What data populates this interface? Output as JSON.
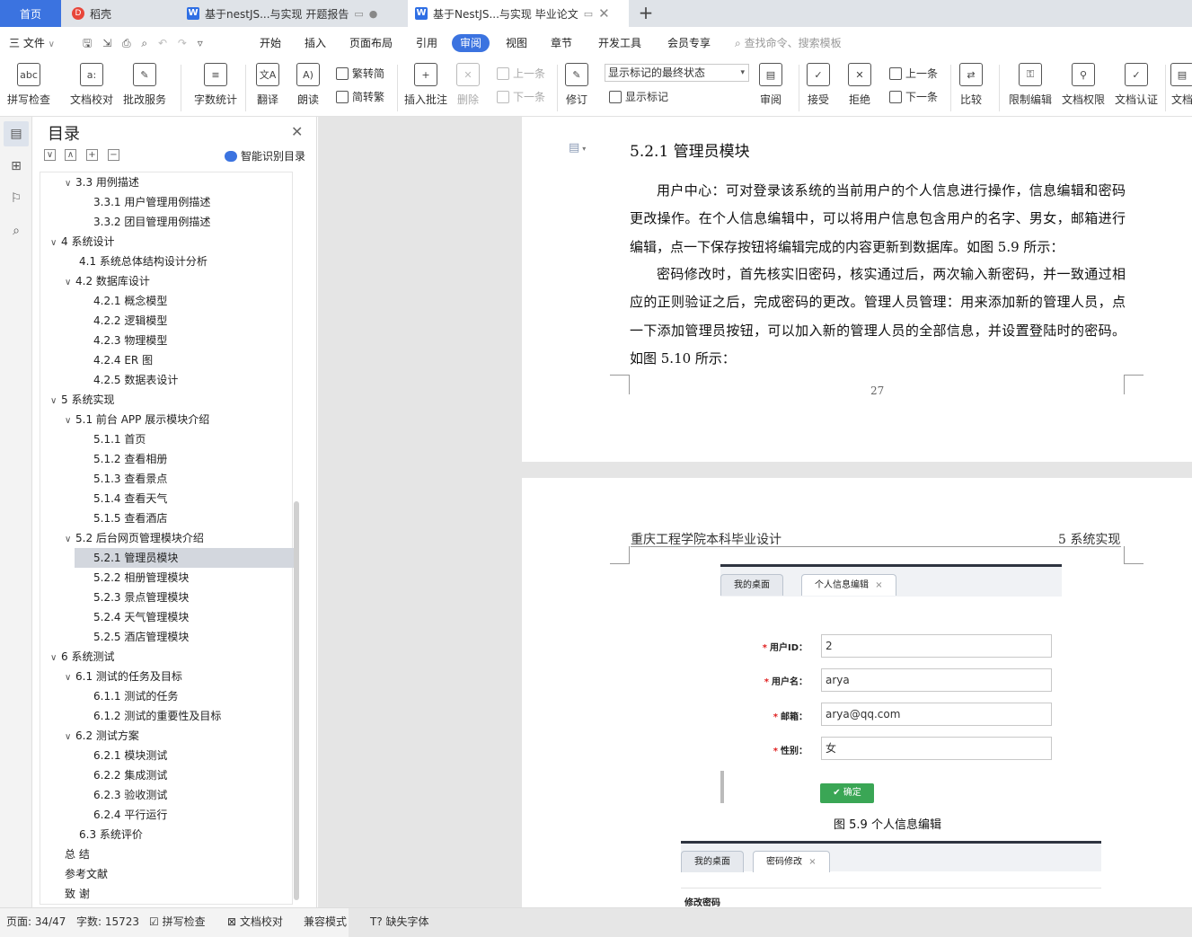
{
  "tabs": {
    "home": "首页",
    "daoke": "稻壳",
    "kaiti": "基于nestJS...与实现 开题报告",
    "lunwen": "基于NestJS...与实现 毕业论文"
  },
  "menu": {
    "file": "三 文件",
    "items": [
      "开始",
      "插入",
      "页面布局",
      "引用",
      "审阅",
      "视图",
      "章节",
      "开发工具",
      "会员专享"
    ],
    "search": "查找命令、搜索模板"
  },
  "ribbon": {
    "spell": "拼写检查",
    "proof": "文档校对",
    "review_service": "批改服务",
    "word_count": "字数统计",
    "translate": "翻译",
    "read_aloud": "朗读",
    "to_trad": "繁转简",
    "to_simp": "简转繁",
    "insert_comment": "插入批注",
    "delete": "删除",
    "prev": "上一条",
    "next": "下一条",
    "track": "修订",
    "markup_state": "显示标记的最终状态",
    "show_markup": "显示标记",
    "review_pane": "审阅",
    "accept": "接受",
    "reject": "拒绝",
    "prev2": "上一条",
    "next2": "下一条",
    "compare": "比较",
    "restrict": "限制编辑",
    "permission": "文档权限",
    "certify": "文档认证",
    "more": "文档"
  },
  "toc": {
    "title": "目录",
    "smart": "智能识别目录",
    "items": [
      {
        "level": 2,
        "text": "3.3 用例描述",
        "arrow": "∨"
      },
      {
        "level": 3,
        "text": "3.3.1 用户管理用例描述"
      },
      {
        "level": 3,
        "text": "3.3.2 团目管理用例描述"
      },
      {
        "level": 1,
        "text": "4 系统设计",
        "arrow": "∨"
      },
      {
        "level": 2,
        "text": "4.1 系统总体结构设计分析"
      },
      {
        "level": 2,
        "text": "4.2 数据库设计",
        "arrow": "∨"
      },
      {
        "level": 3,
        "text": "4.2.1  概念模型"
      },
      {
        "level": 3,
        "text": "4.2.2  逻辑模型"
      },
      {
        "level": 3,
        "text": "4.2.3  物理模型"
      },
      {
        "level": 3,
        "text": "4.2.4 ER 图"
      },
      {
        "level": 3,
        "text": "4.2.5  数据表设计"
      },
      {
        "level": 1,
        "text": "5  系统实现",
        "arrow": "∨"
      },
      {
        "level": 2,
        "text": "5.1 前台 APP 展示模块介绍",
        "arrow": "∨"
      },
      {
        "level": 3,
        "text": "5.1.1  首页"
      },
      {
        "level": 3,
        "text": "5.1.2  查看相册"
      },
      {
        "level": 3,
        "text": "5.1.3  查看景点"
      },
      {
        "level": 3,
        "text": "5.1.4 查看天气"
      },
      {
        "level": 3,
        "text": "5.1.5 查看酒店"
      },
      {
        "level": 2,
        "text": "5.2 后台网页管理模块介绍",
        "arrow": "∨"
      },
      {
        "level": 3,
        "text": "5.2.1  管理员模块",
        "selected": true
      },
      {
        "level": 3,
        "text": "5.2.2  相册管理模块"
      },
      {
        "level": 3,
        "text": "5.2.3 景点管理模块"
      },
      {
        "level": 3,
        "text": "5.2.4 天气管理模块"
      },
      {
        "level": 3,
        "text": "5.2.5  酒店管理模块"
      },
      {
        "level": 1,
        "text": "6  系统测试",
        "arrow": "∨"
      },
      {
        "level": 2,
        "text": "6.1 测试的任务及目标",
        "arrow": "∨"
      },
      {
        "level": 3,
        "text": "6.1.1 测试的任务"
      },
      {
        "level": 3,
        "text": "6.1.2 测试的重要性及目标"
      },
      {
        "level": 2,
        "text": "6.2 测试方案",
        "arrow": "∨"
      },
      {
        "level": 3,
        "text": "6.2.1 模块测试"
      },
      {
        "level": 3,
        "text": "6.2.2 集成测试"
      },
      {
        "level": 3,
        "text": "6.2.3 验收测试"
      },
      {
        "level": 3,
        "text": "6.2.4 平行运行"
      },
      {
        "level": 2,
        "text": "6.3 系统评价"
      },
      {
        "level": 1,
        "text": "总  结"
      },
      {
        "level": 1,
        "text": "参考文献"
      },
      {
        "level": 1,
        "text": "致  谢"
      }
    ]
  },
  "doc": {
    "heading": "5.2.1  管理员模块",
    "para1": "用户中心：可对登录该系统的当前用户的个人信息进行操作，信息编辑和密码更改操作。在个人信息编辑中，可以将用户信息包含用户的名字、男女，邮箱进行编辑，点一下保存按钮将编辑完成的内容更新到数据库。如图 5.9 所示：",
    "para2": "密码修改时，首先核实旧密码，核实通过后，两次输入新密码，并一致通过相应的正则验证之后，完成密码的更改。管理人员管理：用来添加新的管理人员，点一下添加管理员按钮，可以加入新的管理人员的全部信息，并设置登陆时的密码。如图 5.10 所示：",
    "page_number": "27",
    "header_left": "重庆工程学院本科毕业设计",
    "header_right": "5  系统实现",
    "fig1": {
      "tab_desk": "我的桌面",
      "tab_edit": "个人信息编辑",
      "close": "×",
      "fields": [
        {
          "label": "用户ID：",
          "value": "2"
        },
        {
          "label": "用户名：",
          "value": "arya"
        },
        {
          "label": "邮箱：",
          "value": "arya@qq.com"
        },
        {
          "label": "性别：",
          "value": "女"
        }
      ],
      "confirm": "✔ 确定",
      "caption": "图 5.9  个人信息编辑"
    },
    "fig2": {
      "tab_desk": "我的桌面",
      "tab_pwd": "密码修改",
      "close": "×",
      "title": "修改密码"
    }
  },
  "status": {
    "page": "页面: 34/47",
    "words": "字数: 15723",
    "spell": "拼写检查",
    "proof": "文档校对",
    "compat": "兼容模式",
    "missing_font": "缺失字体"
  }
}
